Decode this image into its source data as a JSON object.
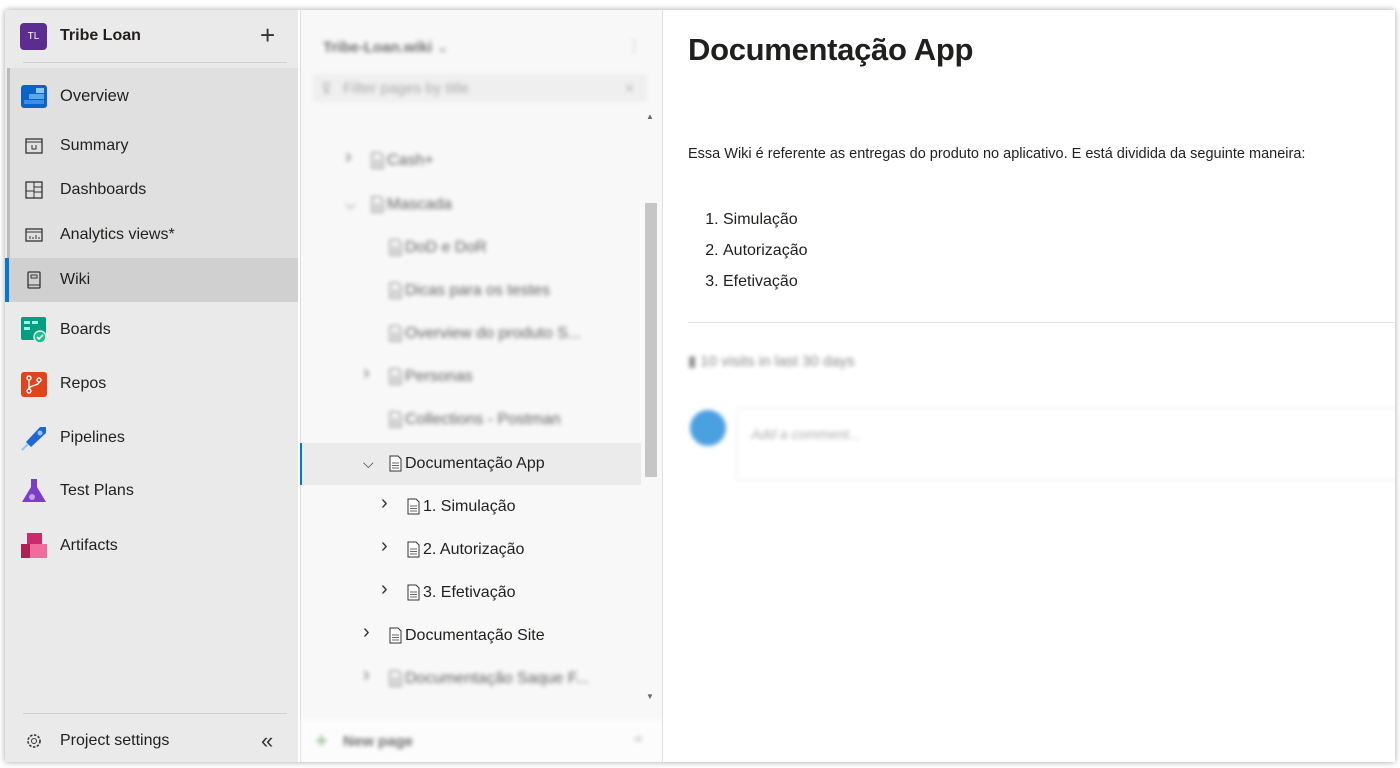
{
  "sidebar": {
    "project": {
      "initials": "TL",
      "name": "Tribe Loan",
      "add_icon": "plus-icon"
    },
    "items": [
      {
        "label": "Overview",
        "icon": "overview-icon"
      },
      {
        "label": "Summary",
        "icon": "summary-icon"
      },
      {
        "label": "Dashboards",
        "icon": "dashboards-icon"
      },
      {
        "label": "Analytics views*",
        "icon": "analytics-icon"
      },
      {
        "label": "Wiki",
        "icon": "wiki-icon",
        "selected": true
      },
      {
        "label": "Boards",
        "icon": "boards-icon"
      },
      {
        "label": "Repos",
        "icon": "repos-icon"
      },
      {
        "label": "Pipelines",
        "icon": "pipelines-icon"
      },
      {
        "label": "Test Plans",
        "icon": "test-plans-icon"
      },
      {
        "label": "Artifacts",
        "icon": "artifacts-icon"
      }
    ],
    "settings": "Project settings",
    "colors": {
      "accent": "#0078d4",
      "avatar": "#5c2d91"
    }
  },
  "tree": {
    "wiki_name": "Tribe-Loan.wiki",
    "filter_placeholder": "Filter pages by title",
    "pages": [
      {
        "title": "Cash+",
        "expander": "collapsed"
      },
      {
        "title": "Mascada",
        "expander": "expanded"
      },
      {
        "title": "DoD e DoR"
      },
      {
        "title": "Dicas para os testes"
      },
      {
        "title": "Overview do produto S..."
      },
      {
        "title": "Personas",
        "expander": "collapsed"
      },
      {
        "title": "Collections - Postman"
      },
      {
        "title": "Documentação App",
        "expander": "expanded",
        "selected": true
      },
      {
        "title": "1. Simulação",
        "expander": "collapsed"
      },
      {
        "title": "2. Autorização",
        "expander": "collapsed"
      },
      {
        "title": "3. Efetivação",
        "expander": "collapsed"
      },
      {
        "title": "Documentação Site",
        "expander": "collapsed"
      },
      {
        "title": "Documentação Saque F...",
        "expander": "collapsed"
      }
    ],
    "new_page": "New page"
  },
  "content": {
    "title": "Documentação App",
    "intro": "Essa Wiki é referente as entregas do produto no aplicativo. E está dividida da seguinte maneira:",
    "list": [
      "Simulação",
      "Autorização",
      "Efetivação"
    ],
    "visits": "10 visits in last 30 days",
    "comment_placeholder": "Add a comment..."
  }
}
